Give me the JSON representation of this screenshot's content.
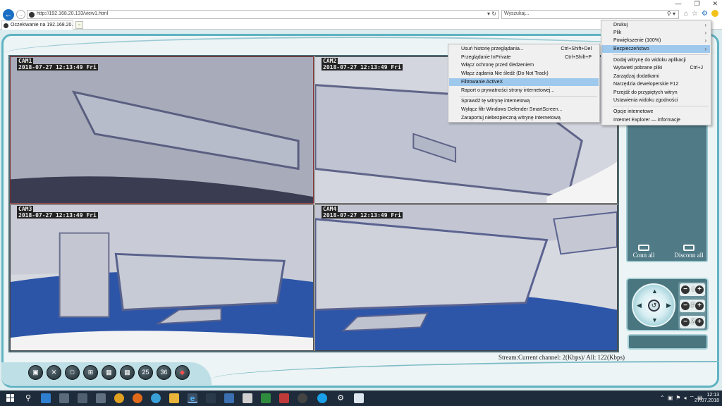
{
  "browser": {
    "url": "http://192.168.20.133/view1.html",
    "search_placeholder": "Wyszukaj...",
    "tab_label": "Oczekiwanie na 192.168.20.",
    "icons": [
      "home-icon",
      "star-icon",
      "gear-icon",
      "smiley-icon"
    ]
  },
  "cameras": [
    {
      "name": "CAM1",
      "timestamp": "2018-07-27 12:13:49 Fri"
    },
    {
      "name": "CAM2",
      "timestamp": "2018-07-27 12:13:49 Fri"
    },
    {
      "name": "CAM3",
      "timestamp": "2018-07-27 12:13:49 Fri"
    },
    {
      "name": "CAM4",
      "timestamp": "2018-07-27 12:13:49 Fri"
    }
  ],
  "stream_status": "Stream:Current channel: 2(Kbps)/ All: 122(Kbps)",
  "side_panel": {
    "connect_all": "Conn all",
    "disconnect_all": "Disconn all"
  },
  "ptz": {
    "iris_label": "I",
    "focus_label": "F",
    "zoom_label": "Z"
  },
  "toolbar_buttons": [
    "video-record-icon",
    "settings-tools-icon",
    "layout-1-icon",
    "layout-4-icon",
    "layout-9-icon",
    "layout-16-icon",
    "layout-25-icon",
    "layout-36-icon",
    "audio-icon"
  ],
  "toolbar_text": {
    "l25": "25",
    "l36": "36"
  },
  "tools_menu": {
    "items": [
      {
        "label": "Drukuj",
        "submenu": true
      },
      {
        "label": "Plik",
        "submenu": true
      },
      {
        "label": "Powiększenie (100%)",
        "submenu": true
      },
      {
        "label": "Bezpieczeństwo",
        "submenu": true,
        "highlighted": true
      },
      {
        "label": "Dodaj witrynę do widoku aplikacji"
      },
      {
        "label": "Wyświetl pobrane pliki",
        "shortcut": "Ctrl+J"
      },
      {
        "label": "Zarządzaj dodatkami"
      },
      {
        "label": "Narzędzia deweloperskie F12"
      },
      {
        "label": "Przejdź do przypiętych witryn"
      },
      {
        "label": "Ustawienia widoku zgodności"
      },
      {
        "label": "Opcje internetowe"
      },
      {
        "label": "Internet Explorer — informacje"
      }
    ]
  },
  "security_menu": {
    "items": [
      {
        "label": "Usuń historię przeglądania...",
        "shortcut": "Ctrl+Shift+Del"
      },
      {
        "label": "Przeglądanie InPrivate",
        "shortcut": "Ctrl+Shift+P"
      },
      {
        "label": "Włącz ochronę przed śledzeniem"
      },
      {
        "label": "Włącz żądania Nie śledź (Do Not Track)"
      },
      {
        "label": "Filtrowanie ActiveX",
        "highlighted": true
      },
      {
        "label": "Raport o prywatności strony internetowej..."
      },
      {
        "label": "Sprawdź tę witrynę internetową"
      },
      {
        "label": "Wyłącz filtr Windows Defender SmartScreen..."
      },
      {
        "label": "Zaraportuj niebezpieczną witrynę internetową"
      }
    ]
  },
  "taskbar": {
    "time": "12:13",
    "date": "27.07.2018",
    "apps": [
      "start-icon",
      "search-icon",
      "app-icon",
      "app-icon",
      "app-icon",
      "chrome-icon",
      "firefox-icon",
      "app-icon",
      "file-explorer-icon",
      "internet-explorer-icon",
      "app-icon",
      "app-icon",
      "app-icon",
      "app-icon",
      "app-icon",
      "skype-icon",
      "settings-icon",
      "app-icon"
    ]
  },
  "colors": {
    "accent": "#5fb3c2",
    "panel": "#4f7a86",
    "menu_highlight": "#9fc8ed",
    "taskbar": "#1d2b3a"
  }
}
